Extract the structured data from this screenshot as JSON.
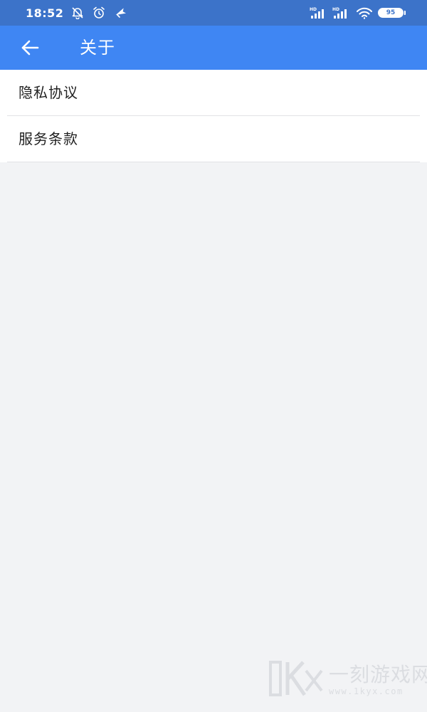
{
  "status_bar": {
    "time": "18:52",
    "battery_level": "95",
    "left_icons": [
      "snooze-bell-icon",
      "alarm-clock-icon",
      "airplane-icon"
    ],
    "right_icons": [
      "hd-signal-icon",
      "hd-signal-icon",
      "wifi-icon",
      "battery-icon"
    ],
    "signal_tag": "HD"
  },
  "app_bar": {
    "title": "关于",
    "back_icon": "arrow-left-icon"
  },
  "menu": {
    "items": [
      {
        "label": "隐私协议"
      },
      {
        "label": "服务条款"
      }
    ]
  },
  "watermark": {
    "text": "一刻游戏网",
    "url": "www.1kyx.com",
    "logo_text": "1K"
  },
  "colors": {
    "status_bar": "#3c73c9",
    "app_bar": "#3f86f3",
    "page_background": "#f2f3f5",
    "list_background": "#ffffff"
  }
}
